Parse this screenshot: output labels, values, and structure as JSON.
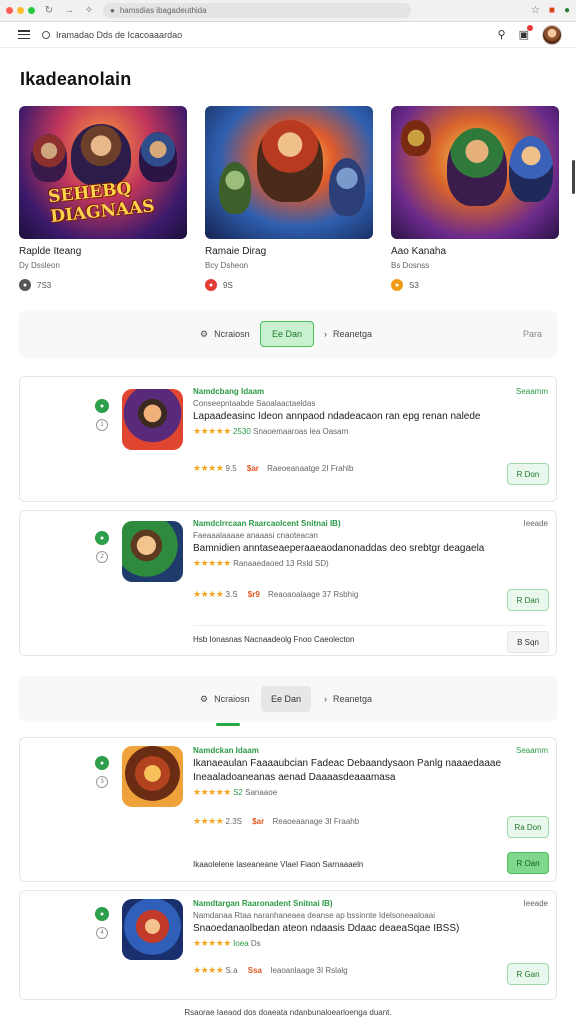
{
  "browser": {
    "url": "hamsdias ibagadeuthida",
    "dot_colors": [
      "#ff5f57",
      "#febc2e",
      "#28c840"
    ]
  },
  "appbar": {
    "title": "Iramadao Dds de Icacoaaardao"
  },
  "section": {
    "title": "Ikadeanolain"
  },
  "featured": [
    {
      "title": "Raplde Iteang",
      "subtitle": "Dy Dssleon",
      "meta": "7S3",
      "badge_color": "#555555"
    },
    {
      "title": "Ramaie Dirag",
      "subtitle": "Bcy Dsheon",
      "meta": "9S",
      "badge_color": "#e53935"
    },
    {
      "title": "Aao Kanaha",
      "subtitle": "Bs Dosnss",
      "meta": "S3",
      "badge_color": "#f39c12"
    }
  ],
  "logo_text": "SEHEBQ DIAGNAAS",
  "filterbar1": {
    "left": "Ncraiosn",
    "active": "Ee Dan",
    "right": "Reanetga",
    "corner": "Para"
  },
  "filterbar2": {
    "left": "Ncraiosn",
    "active": "Ee Dan",
    "right": "Reanetga"
  },
  "results": [
    {
      "publisher": "Namdcbang Idaam",
      "corner": "Seaamm",
      "sub": "Conseepntaabde Saoalaactaeldas",
      "title": "Lapaadeasinc Ideon annpaod ndadeacaon ran epg renan nalede",
      "stars_line": "Snaoemaaroas lea Oasam",
      "stars_badge": "2530",
      "rating": "9.5",
      "price": "$ar",
      "foot": "Raeoeanaatge 2I Frahlb",
      "button": "R Don"
    },
    {
      "publisher": "Namdclrrcaan Raarcaolcent Snitnai IB)",
      "corner": "Ieeade",
      "sub": "Faeaaalaaaae anaaasi cnaoteacan",
      "title": "Bamnidien anntaseaeperaaeaodanonaddas deo srebtgr deagaela",
      "stars_line": "Ranaaedaoed 13 Rsld SD)",
      "stars_badge": "",
      "rating": "3.S",
      "price": "$r9",
      "foot": "Reaoaoalaage 37 Rsbhig",
      "button": "R Dan",
      "note": "Hsb Ionasnas Nacnaadeolg Fnoo Caeolecton",
      "note_button": "B Sqn"
    },
    {
      "publisher": "Namdckan Idaam",
      "corner": "Seaamm",
      "sub": "Ikanaeaulan Faaaaubcian Fadeac Debaandysaon Panlg naaaedaaae",
      "title": "Ineaaladoaneanas aenad Daaaasdeaaamasa",
      "stars_line": "Sanaaoe",
      "stars_badge": "S2",
      "rating": "2.3S",
      "price": "$ar",
      "foot": "Reaoeaanage 3I Fraahb",
      "button": "Ra Don",
      "note": "Ikaaolelene Iaseaneane Vlael Fiaon Sarnaaaeln",
      "note_button": "R Oan"
    },
    {
      "publisher": "Namdtargan Raaronadent Snitnai IB)",
      "corner": "Ieeade",
      "sub": "Namdanaa Rtaa naranhaneaea deanse ap bssinnte Idelsoneaaloaai",
      "title": "Snaoedanaolbedan ateon ndaasis Ddaac deaeaSqae IBSS)",
      "stars_line": "Ds",
      "stars_badge": "Ioea",
      "rating": "S.a",
      "price": "Ssa",
      "foot": "Ieaoanlaage 3I Rslalg",
      "button": "R Gan"
    }
  ],
  "footer": "Rsaorae Iaeaod dos doaeata ndanbunaloearloenga duant."
}
